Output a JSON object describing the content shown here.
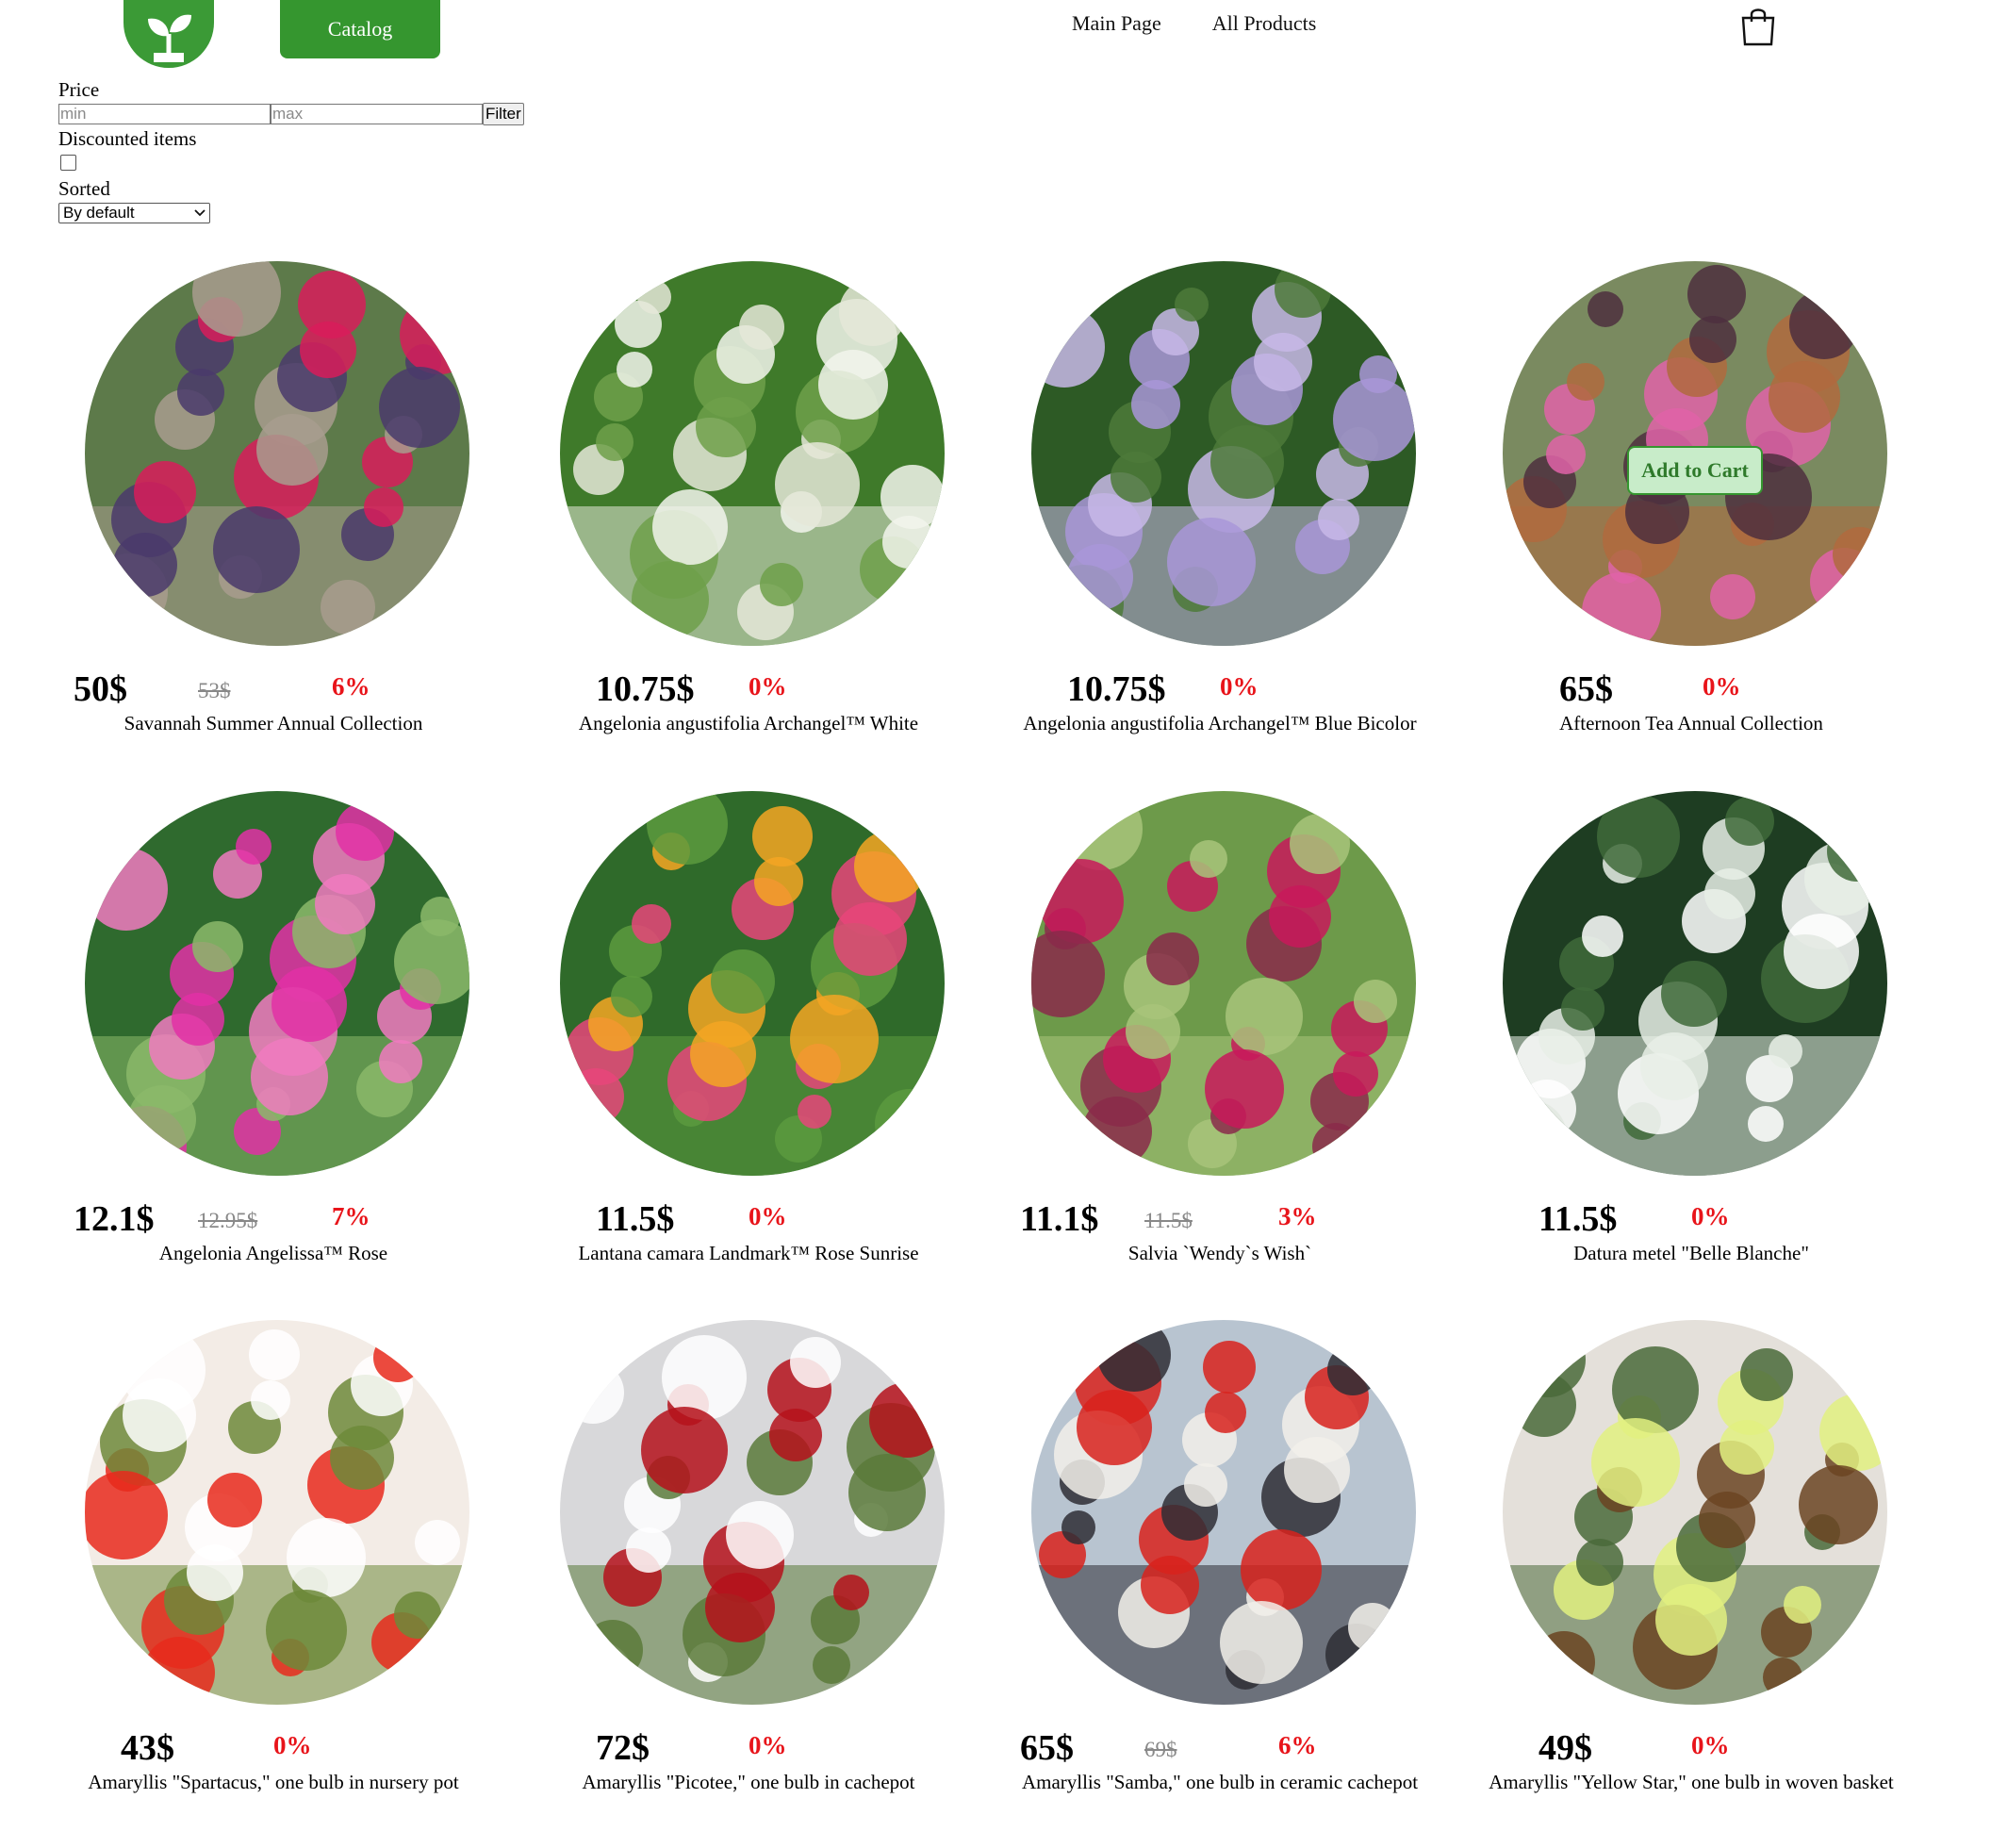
{
  "header": {
    "catalog_label": "Catalog",
    "nav": [
      "Main Page",
      "All Products"
    ]
  },
  "filters": {
    "price_label": "Price",
    "min_placeholder": "min",
    "max_placeholder": "max",
    "filter_label": "Filter",
    "discounted_label": "Discounted items",
    "discounted_checked": false,
    "sorted_label": "Sorted",
    "sort_value": "By default"
  },
  "add_to_cart_label": "Add to Cart",
  "products": [
    {
      "name": "Savannah Summer Annual Collection",
      "price": "50$",
      "old_price": "53$",
      "discount": "6%",
      "palette": [
        "#5d7a4a",
        "#d81c5b",
        "#4a3a6b",
        "#a89c8e"
      ]
    },
    {
      "name": "Angelonia angustifolia Archangel™ White",
      "price": "10.75$",
      "old_price": "",
      "discount": "0%",
      "palette": [
        "#3f7a2a",
        "#f2f4ec",
        "#6ea04a",
        "#e5e8d8"
      ]
    },
    {
      "name": "Angelonia angustifolia Archangel™ Blue Bicolor",
      "price": "10.75$",
      "old_price": "",
      "discount": "0%",
      "palette": [
        "#2d5a25",
        "#a996d8",
        "#4d7a3a",
        "#c8b8e8"
      ]
    },
    {
      "name": "Afternoon Tea Annual Collection",
      "price": "65$",
      "old_price": "",
      "discount": "0%",
      "palette": [
        "#7a8a60",
        "#e063a8",
        "#4e2f3e",
        "#b06a3e"
      ]
    },
    {
      "name": "Angelonia Angelissa™ Rose",
      "price": "12.1$",
      "old_price": "12.95$",
      "discount": "7%",
      "palette": [
        "#2f6a2e",
        "#e230a6",
        "#f07ac0",
        "#8bb86a"
      ]
    },
    {
      "name": "Lantana camara Landmark™ Rose Sunrise",
      "price": "11.5$",
      "old_price": "",
      "discount": "0%",
      "palette": [
        "#2f6a2a",
        "#f5a623",
        "#e8457a",
        "#5c9a3e"
      ]
    },
    {
      "name": "Salvia `Wendy`s Wish`",
      "price": "11.1$",
      "old_price": "11.5$",
      "discount": "3%",
      "palette": [
        "#6d9a4a",
        "#c8195a",
        "#8a2a4a",
        "#a8c47a"
      ]
    },
    {
      "name": "Datura metel \"Belle Blanche\"",
      "price": "11.5$",
      "old_price": "",
      "discount": "0%",
      "palette": [
        "#1e3d22",
        "#ffffff",
        "#3f6a3a",
        "#e8efe6"
      ]
    },
    {
      "name": "Amaryllis \"Spartacus,\" one bulb in nursery pot",
      "price": "43$",
      "old_price": "",
      "discount": "0%",
      "palette": [
        "#f3ece6",
        "#e82a1c",
        "#ffffff",
        "#6d8a3a"
      ]
    },
    {
      "name": "Amaryllis \"Picotee,\" one bulb in cachepot",
      "price": "72$",
      "old_price": "",
      "discount": "0%",
      "palette": [
        "#d8d8da",
        "#ffffff",
        "#b5121b",
        "#5a7a3a"
      ]
    },
    {
      "name": "Amaryllis \"Samba,\" one bulb in ceramic cachepot",
      "price": "65$",
      "old_price": "69$",
      "discount": "6%",
      "palette": [
        "#b8c4d0",
        "#d8221c",
        "#f2f0ea",
        "#2e2e35"
      ]
    },
    {
      "name": "Amaryllis \"Yellow Star,\" one bulb in woven basket",
      "price": "49$",
      "old_price": "",
      "discount": "0%",
      "palette": [
        "#e4e0da",
        "#e2f080",
        "#6b4422",
        "#4a6a3a"
      ]
    }
  ]
}
